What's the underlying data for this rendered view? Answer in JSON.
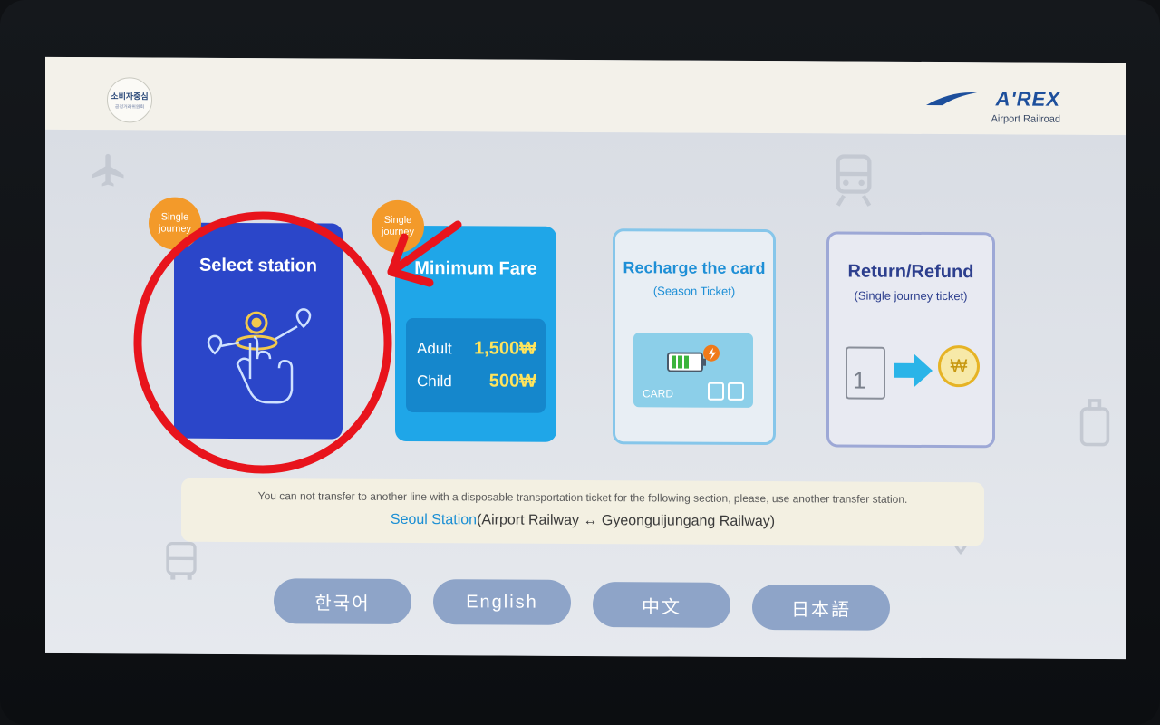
{
  "header": {
    "seal_text_top": "소비자중심",
    "seal_text_bottom": "공정거래위원회",
    "brand_name": "A'REX",
    "brand_sub": "Airport Railroad"
  },
  "cards": {
    "select_station": {
      "badge_line1": "Single",
      "badge_line2": "journey",
      "title": "Select station",
      "bg_color": "#2b46c9"
    },
    "minimum_fare": {
      "badge_line1": "Single",
      "badge_line2": "journey",
      "title": "Minimum Fare",
      "adult_label": "Adult",
      "adult_value": "1,500₩",
      "child_label": "Child",
      "child_value": "500₩",
      "bg_color": "#1fa6e8"
    },
    "recharge": {
      "title": "Recharge the card",
      "subtitle": "(Season Ticket)",
      "card_label": "CARD"
    },
    "refund": {
      "title": "Return/Refund",
      "subtitle": "(Single journey ticket)",
      "ticket_number": "1",
      "coin_symbol": "₩"
    }
  },
  "notice": {
    "line1": "You can not transfer to another line with a disposable transportation ticket for the following section, please, use another transfer station.",
    "highlight": "Seoul Station",
    "line2_rest": "(Airport Railway ↔ Gyeonguijungang Railway)"
  },
  "languages": [
    "한국어",
    "English",
    "中文",
    "日本語"
  ],
  "colors": {
    "accent_blue": "#2b46c9",
    "sky_blue": "#1fa6e8",
    "badge_orange": "#f39a2a",
    "fare_yellow": "#ffe45c",
    "annotation_red": "#e8141c",
    "lang_button": "#8ea4c8"
  },
  "icons": {
    "select": "tap-hand-icon",
    "recharge": "battery-card-icon",
    "refund": "ticket-to-coin-icon"
  }
}
